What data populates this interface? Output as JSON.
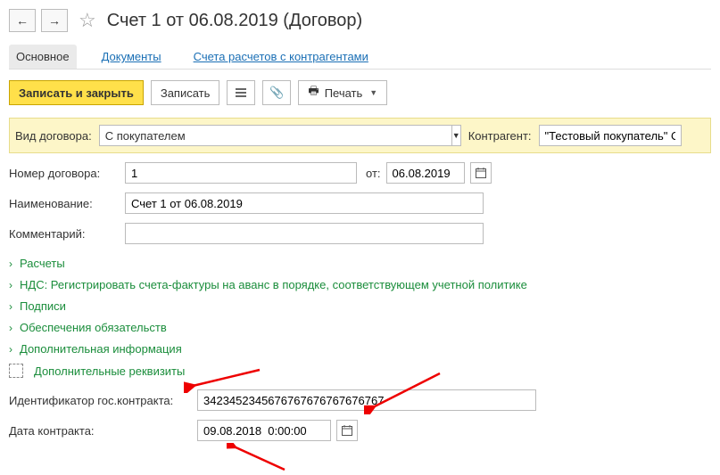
{
  "title": "Счет 1 от 06.08.2019 (Договор)",
  "tabs": {
    "main": "Основное",
    "documents": "Документы",
    "settlements": "Счета расчетов с контрагентами"
  },
  "toolbar": {
    "save_close": "Записать и закрыть",
    "save": "Записать",
    "print": "Печать"
  },
  "contract_type_label": "Вид договора:",
  "contract_type_value": "С покупателем",
  "counterparty_label": "Контрагент:",
  "counterparty_value": "\"Тестовый покупатель\" ООО",
  "number_label": "Номер договора:",
  "number_value": "1",
  "from_label": "от:",
  "from_date": "06.08.2019",
  "name_label": "Наименование:",
  "name_value": "Счет 1 от 06.08.2019",
  "comment_label": "Комментарий:",
  "comment_value": "",
  "sections": {
    "calc": "Расчеты",
    "vat": "НДС: Регистрировать счета-фактуры на аванс в порядке, соответствующем учетной политике",
    "sign": "Подписи",
    "obl": "Обеспечения обязательств",
    "addinfo": "Дополнительная информация",
    "addreq": "Дополнительные реквизиты"
  },
  "gov_id_label": "Идентификатор гос.контракта:",
  "gov_id_value": "3423452345676767676767676767",
  "contract_date_label": "Дата контракта:",
  "contract_date_value": "09.08.2018  0:00:00"
}
